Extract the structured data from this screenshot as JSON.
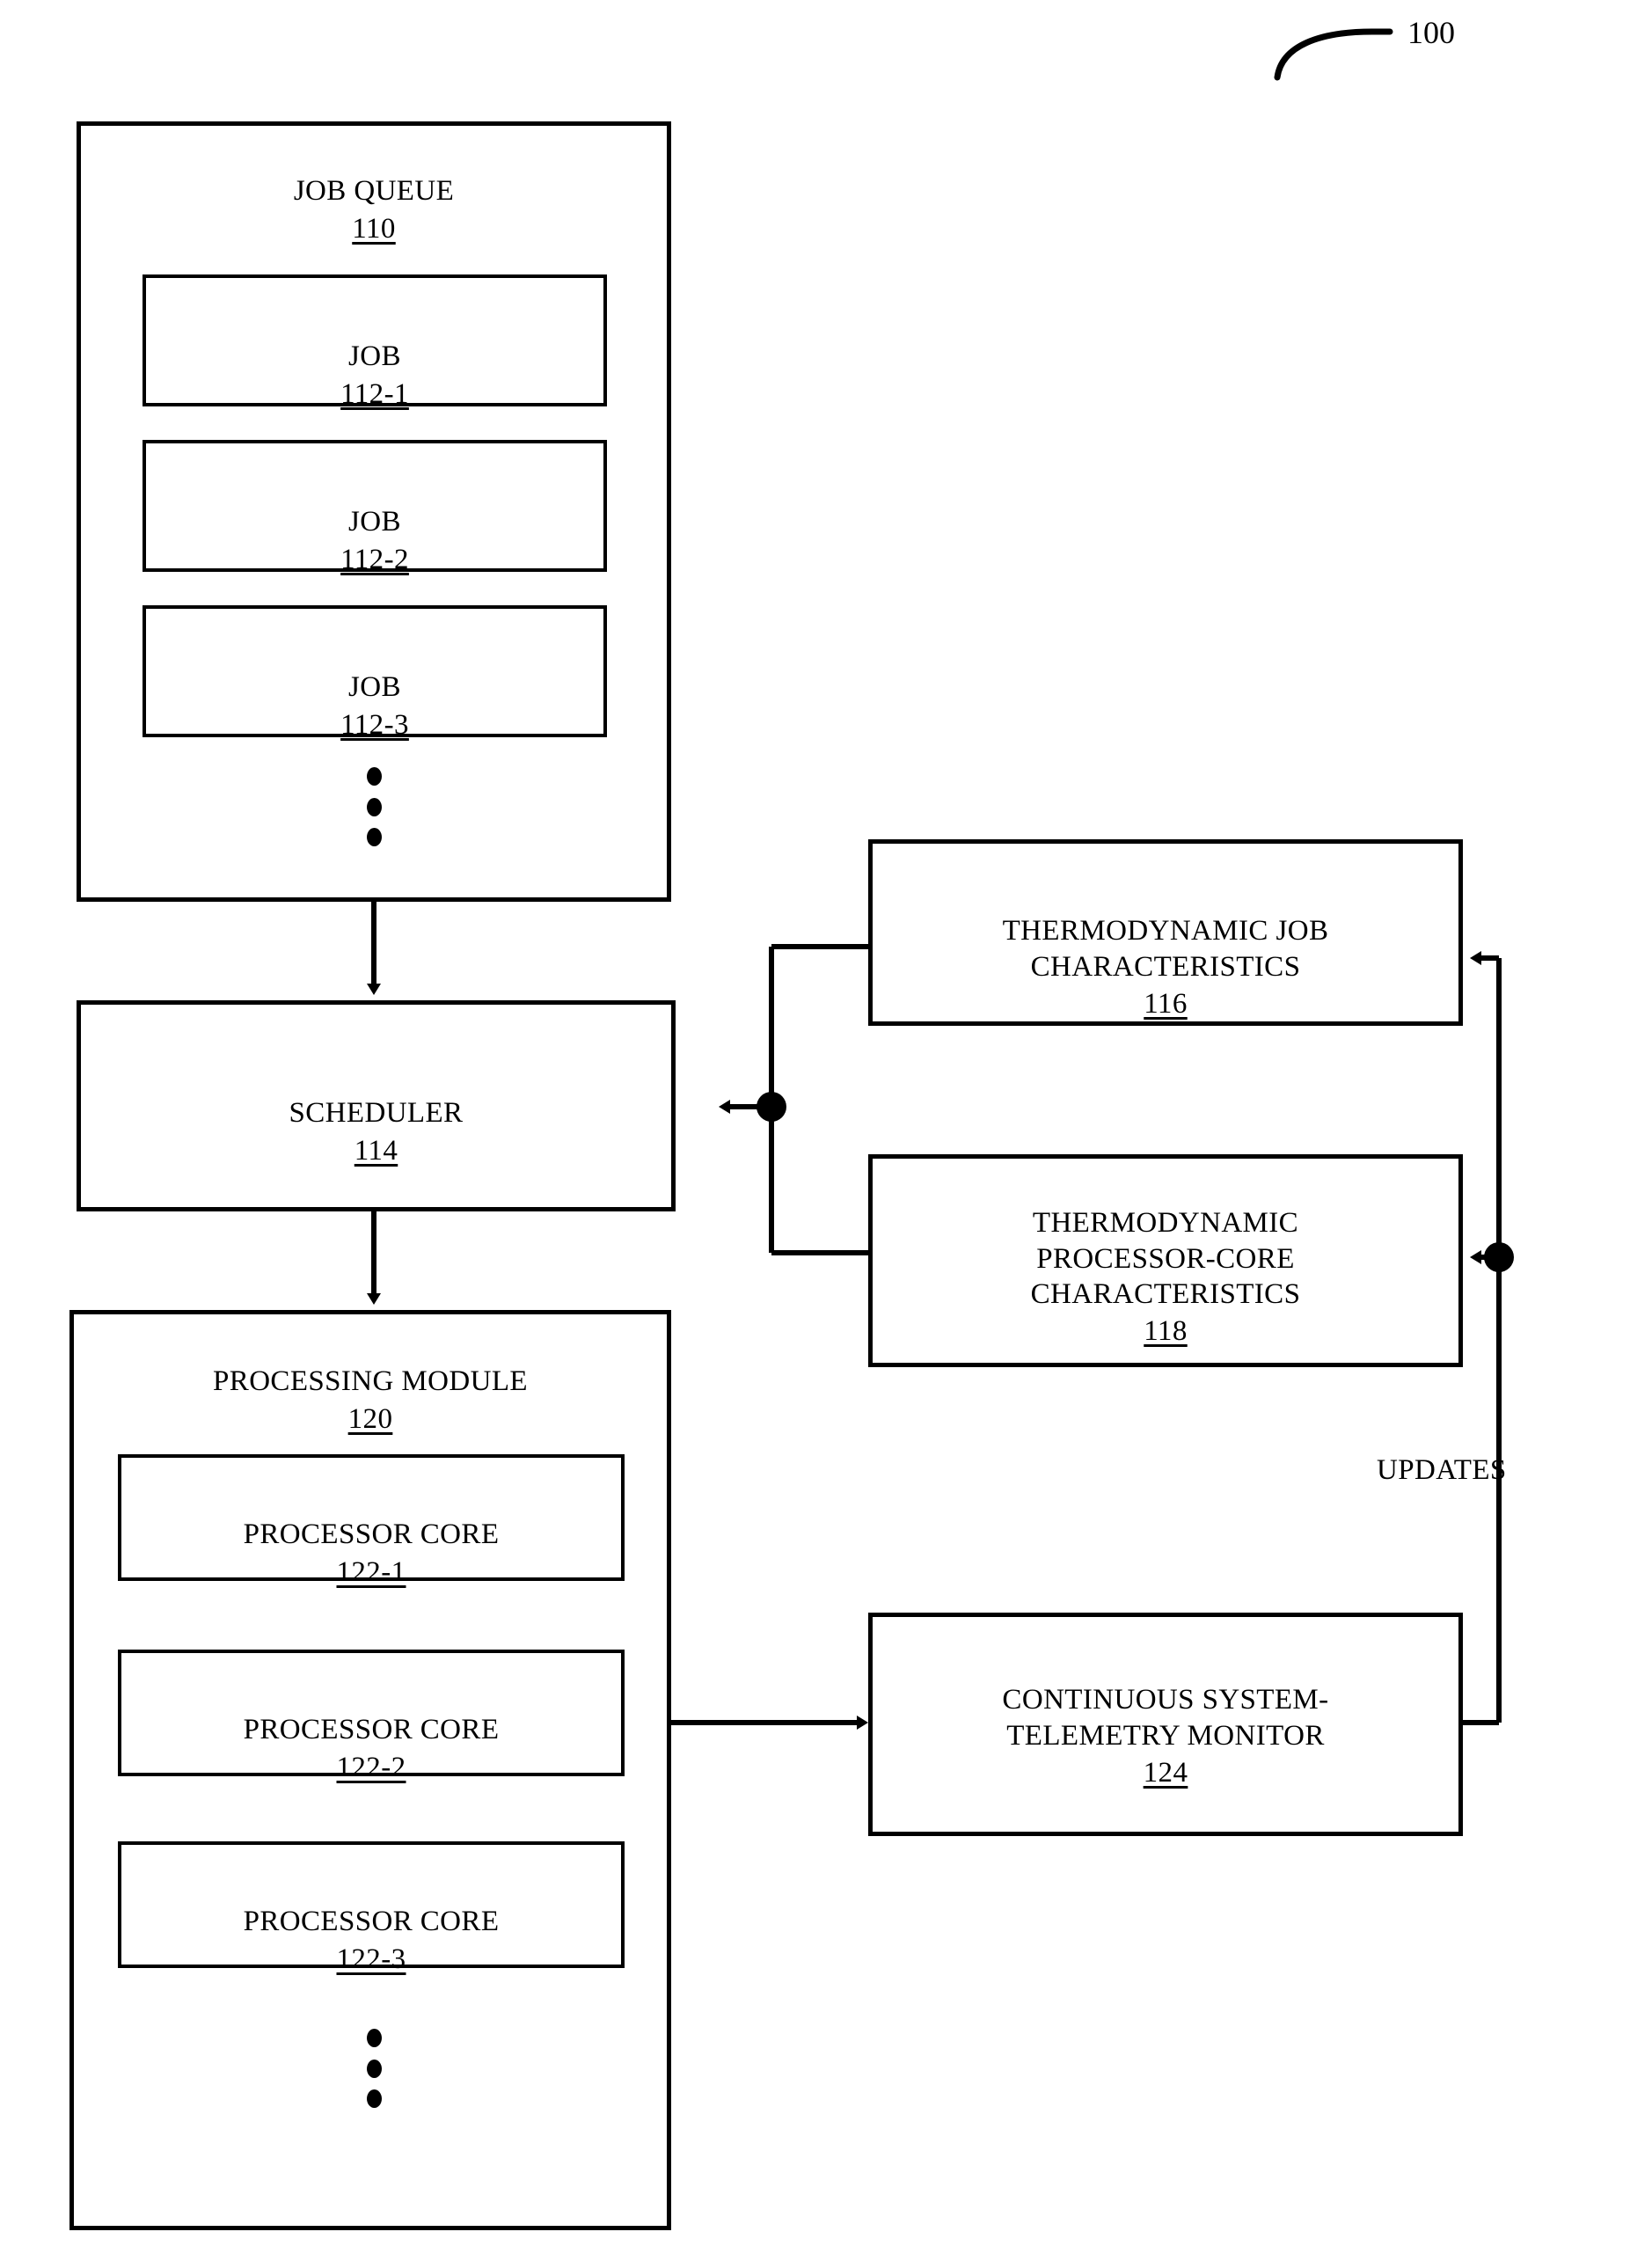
{
  "figure": {
    "number": "100",
    "type": "patent-block-diagram"
  },
  "blocks": {
    "job_queue": {
      "title": "JOB QUEUE",
      "ref": "110"
    },
    "job_1": {
      "title": "JOB",
      "ref": "112-1"
    },
    "job_2": {
      "title": "JOB",
      "ref": "112-2"
    },
    "job_3": {
      "title": "JOB",
      "ref": "112-3"
    },
    "scheduler": {
      "title": "SCHEDULER",
      "ref": "114"
    },
    "thermo_job": {
      "title": "THERMODYNAMIC JOB\nCHARACTERISTICS",
      "ref": "116"
    },
    "thermo_core": {
      "title": "THERMODYNAMIC\nPROCESSOR-CORE\nCHARACTERISTICS",
      "ref": "118"
    },
    "processing_module": {
      "title": "PROCESSING MODULE",
      "ref": "120"
    },
    "core_1": {
      "title": "PROCESSOR CORE",
      "ref": "122-1"
    },
    "core_2": {
      "title": "PROCESSOR CORE",
      "ref": "122-2"
    },
    "core_3": {
      "title": "PROCESSOR CORE",
      "ref": "122-3"
    },
    "telemetry_monitor": {
      "title": "CONTINUOUS SYSTEM-\nTELEMETRY MONITOR",
      "ref": "124"
    }
  },
  "annotations": {
    "updates": "UPDATES"
  },
  "colors": {
    "stroke": "#000000",
    "fill": "#ffffff"
  }
}
